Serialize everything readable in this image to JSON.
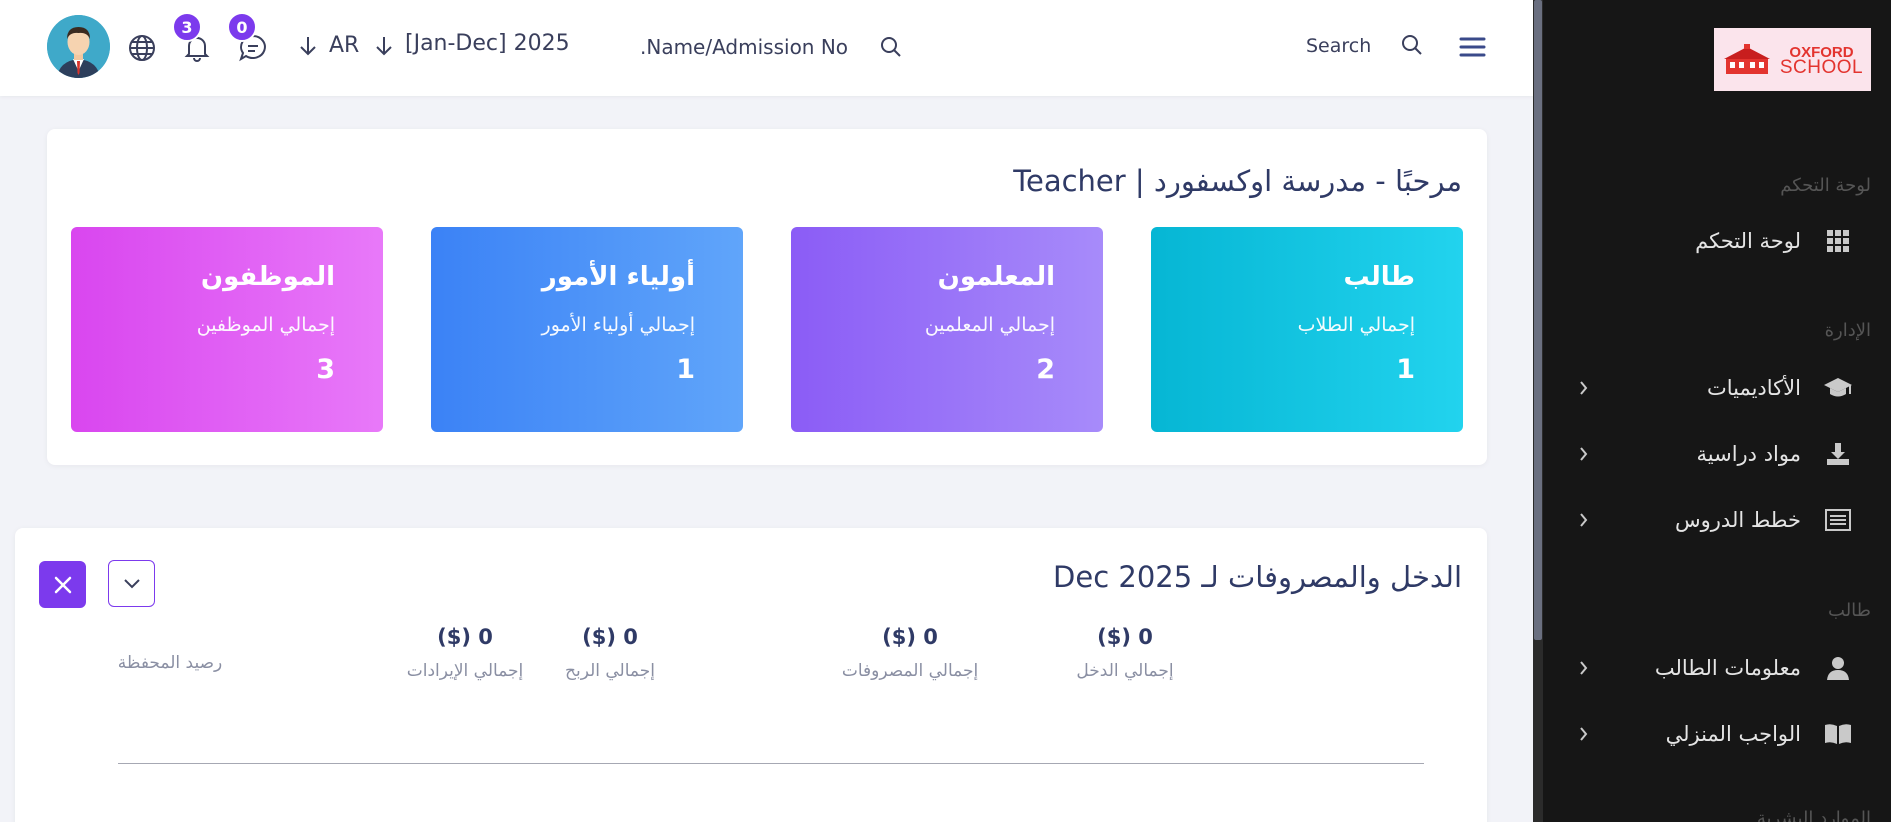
{
  "sidebar": {
    "logo_line1": "OXFORD",
    "logo_line2": "SCHOOL",
    "sections": {
      "dashboard": "لوحة التحكم",
      "admin": "الإدارة",
      "student": "طالب",
      "partial": "الموارد البشرية"
    },
    "items": [
      {
        "label": "لوحة التحكم",
        "icon": "grid-icon"
      },
      {
        "label": "الأكاديميات",
        "icon": "graduation-cap-icon"
      },
      {
        "label": "مواد دراسية",
        "icon": "download-icon"
      },
      {
        "label": "خطط الدروس",
        "icon": "list-icon"
      },
      {
        "label": "معلومات الطالب",
        "icon": "user-icon"
      },
      {
        "label": "الواجب المنزلي",
        "icon": "book-icon"
      }
    ]
  },
  "header": {
    "notifications_count": "3",
    "messages_count": "0",
    "language": "AR",
    "session": "[Jan-Dec] 2025",
    "search_placeholder": "Name/Admission No.",
    "search_label": "Search"
  },
  "welcome": {
    "title": "مرحبًا - مدرسة اوكسفورد | Teacher",
    "stats": [
      {
        "title": "طالب",
        "subtitle": "إجمالي الطلاب",
        "value": "1",
        "from": "#06b6d4",
        "to": "#22d3ee"
      },
      {
        "title": "المعلمون",
        "subtitle": "إجمالي المعلمين",
        "value": "2",
        "from": "#8b5cf6",
        "to": "#a78bfa"
      },
      {
        "title": "أولياء الأمور",
        "subtitle": "إجمالي أولياء الأمور",
        "value": "1",
        "from": "#3b82f6",
        "to": "#60a5fa"
      },
      {
        "title": "الموظفون",
        "subtitle": "إجمالي الموظفين",
        "value": "3",
        "from": "#d946ef",
        "to": "#e879f9"
      }
    ]
  },
  "finance": {
    "title": "الدخل والمصروفات لـ Dec 2025",
    "stats": [
      {
        "value": "0 ($)",
        "label": "إجمالي الدخل"
      },
      {
        "value": "0 ($)",
        "label": "إجمالي المصروفات"
      },
      {
        "value": "0 ($)",
        "label": "إجمالي الربح"
      },
      {
        "value": "0 ($)",
        "label": "إجمالي الإيرادات"
      },
      {
        "value": "",
        "label": "رصيد المحفظة"
      }
    ]
  },
  "colors": {
    "accent": "#7c3aed",
    "sidebar": "#161616"
  }
}
